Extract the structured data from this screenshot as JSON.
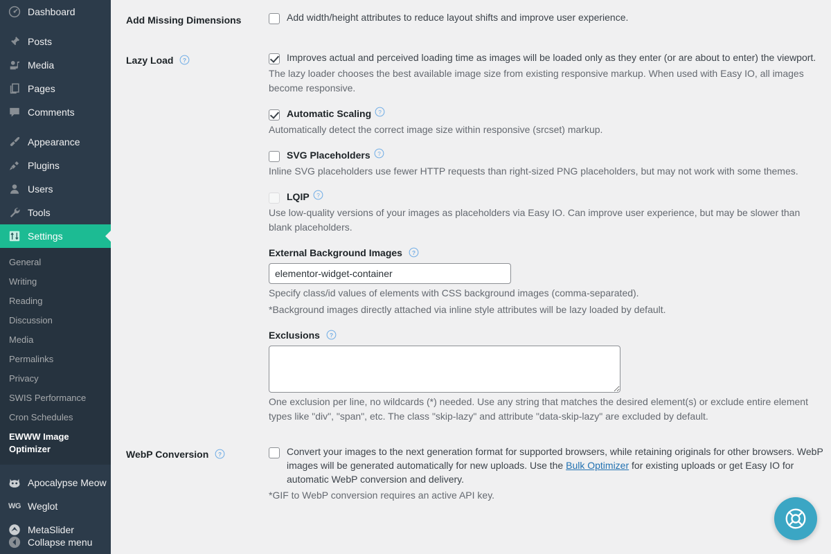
{
  "sidebar": {
    "primary_items": [
      {
        "label": "Dashboard",
        "icon": "dashboard-icon",
        "current": false,
        "gap_after": true
      },
      {
        "label": "Posts",
        "icon": "pin-icon",
        "current": false,
        "gap_after": false
      },
      {
        "label": "Media",
        "icon": "media-icon",
        "current": false,
        "gap_after": false
      },
      {
        "label": "Pages",
        "icon": "pages-icon",
        "current": false,
        "gap_after": false
      },
      {
        "label": "Comments",
        "icon": "comment-icon",
        "current": false,
        "gap_after": true
      },
      {
        "label": "Appearance",
        "icon": "brush-icon",
        "current": false,
        "gap_after": false
      },
      {
        "label": "Plugins",
        "icon": "plug-icon",
        "current": false,
        "gap_after": false
      },
      {
        "label": "Users",
        "icon": "user-icon",
        "current": false,
        "gap_after": false
      },
      {
        "label": "Tools",
        "icon": "wrench-icon",
        "current": false,
        "gap_after": false
      },
      {
        "label": "Settings",
        "icon": "sliders-icon",
        "current": true,
        "gap_after": false
      }
    ],
    "submenu_items": [
      {
        "label": "General",
        "current": false
      },
      {
        "label": "Writing",
        "current": false
      },
      {
        "label": "Reading",
        "current": false
      },
      {
        "label": "Discussion",
        "current": false
      },
      {
        "label": "Media",
        "current": false
      },
      {
        "label": "Permalinks",
        "current": false
      },
      {
        "label": "Privacy",
        "current": false
      },
      {
        "label": "SWIS Performance",
        "current": false
      },
      {
        "label": "Cron Schedules",
        "current": false
      },
      {
        "label": "EWWW Image Optimizer",
        "current": true
      }
    ],
    "plugin_items": [
      {
        "label": "Apocalypse Meow",
        "icon": "cat-icon"
      },
      {
        "label": "Weglot",
        "icon": "weglot-icon"
      },
      {
        "label": "MetaSlider",
        "icon": "metaslider-icon"
      }
    ],
    "collapse": {
      "label": "Collapse menu",
      "icon": "collapse-arrow-icon"
    },
    "colors": {
      "background": "#2c3b4a",
      "submenu_background": "#26333f",
      "current_highlight": "#1cbb93",
      "text": "#f0f0f1",
      "muted_text": "#a7aaad"
    }
  },
  "settings": {
    "add_missing_dimensions": {
      "label": "Add Missing Dimensions",
      "checkbox_label": "Add width/height attributes to reduce layout shifts and improve user experience.",
      "checked": false,
      "has_help": false
    },
    "lazy_load": {
      "label": "Lazy Load",
      "has_help": true,
      "checked": true,
      "checkbox_label": "Improves actual and perceived loading time as images will be loaded only as they enter (or are about to enter) the viewport.",
      "description": "The lazy loader chooses the best available image size from existing responsive markup. When used with Easy IO, all images become responsive.",
      "automatic_scaling": {
        "label": "Automatic Scaling",
        "checked": true,
        "has_help": true,
        "description": "Automatically detect the correct image size within responsive (srcset) markup."
      },
      "svg_placeholders": {
        "label": "SVG Placeholders",
        "checked": false,
        "has_help": true,
        "description": "Inline SVG placeholders use fewer HTTP requests than right-sized PNG placeholders, but may not work with some themes."
      },
      "lqip": {
        "label": "LQIP",
        "checked": false,
        "disabled": true,
        "has_help": true,
        "description": "Use low-quality versions of your images as placeholders via Easy IO. Can improve user experience, but may be slower than blank placeholders."
      },
      "external_background_images": {
        "label": "External Background Images",
        "has_help": true,
        "value": "elementor-widget-container",
        "placeholder": "",
        "description_line_1": "Specify class/id values of elements with CSS background images (comma-separated).",
        "description_line_2": "*Background images directly attached via inline style attributes will be lazy loaded by default."
      },
      "exclusions": {
        "label": "Exclusions",
        "has_help": true,
        "value": "",
        "placeholder": "",
        "description": "One exclusion per line, no wildcards (*) needed. Use any string that matches the desired element(s) or exclude entire element types like \"div\", \"span\", etc. The class \"skip-lazy\" and attribute \"data-skip-lazy\" are excluded by default."
      }
    },
    "webp_conversion": {
      "label": "WebP Conversion",
      "has_help": true,
      "checked": false,
      "checkbox_label": "Convert your images to the next generation format for supported browsers, while retaining originals for other browsers.",
      "body_before_link": "WebP images will be generated automatically for new uploads. Use the ",
      "link_label": "Bulk Optimizer",
      "body_after_link": " for existing uploads or get Easy IO for automatic WebP conversion and delivery.",
      "footnote": "*GIF to WebP conversion requires an active API key."
    }
  },
  "support": {
    "button_label": "Support",
    "icon": "lifebuoy-icon",
    "color": "#3ba6c4"
  }
}
